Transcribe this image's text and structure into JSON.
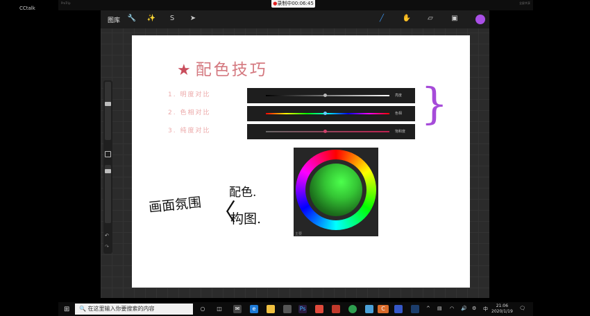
{
  "app": {
    "name": "CCtalk"
  },
  "recording": {
    "label": "录制中00:06:45"
  },
  "top": {
    "subtitle": "ProTrip",
    "right_text": "全屏共享"
  },
  "toolbar": {
    "gallery_label": "图库",
    "left_icons": [
      "wrench-icon",
      "magic-wand-icon",
      "s-curve-icon",
      "arrow-icon"
    ],
    "right_icons": [
      "brush-icon",
      "smudge-icon",
      "eraser-icon",
      "layers-icon"
    ],
    "color_swatch": "#a94fe6"
  },
  "slide": {
    "title": "配色技巧",
    "items": [
      "1. 明度对比",
      "2. 色相对比",
      "3. 纯度对比"
    ],
    "bars": [
      {
        "label": "亮度",
        "value": 0.48
      },
      {
        "label": "色相",
        "value": 0.48
      },
      {
        "label": "饱和度",
        "value": 0.48
      }
    ],
    "wheel_label": "主要",
    "handwriting": {
      "left": "画面氛围",
      "right_top": "配色.",
      "right_bottom": "构图."
    }
  },
  "taskbar": {
    "search_placeholder": "在这里输入你要搜索的内容",
    "time": "21:06",
    "date": "2020/1/19",
    "ime": "中"
  },
  "colors": {
    "accent": "#a94fe6",
    "title": "#d4787f",
    "items": "#eca8a8"
  }
}
